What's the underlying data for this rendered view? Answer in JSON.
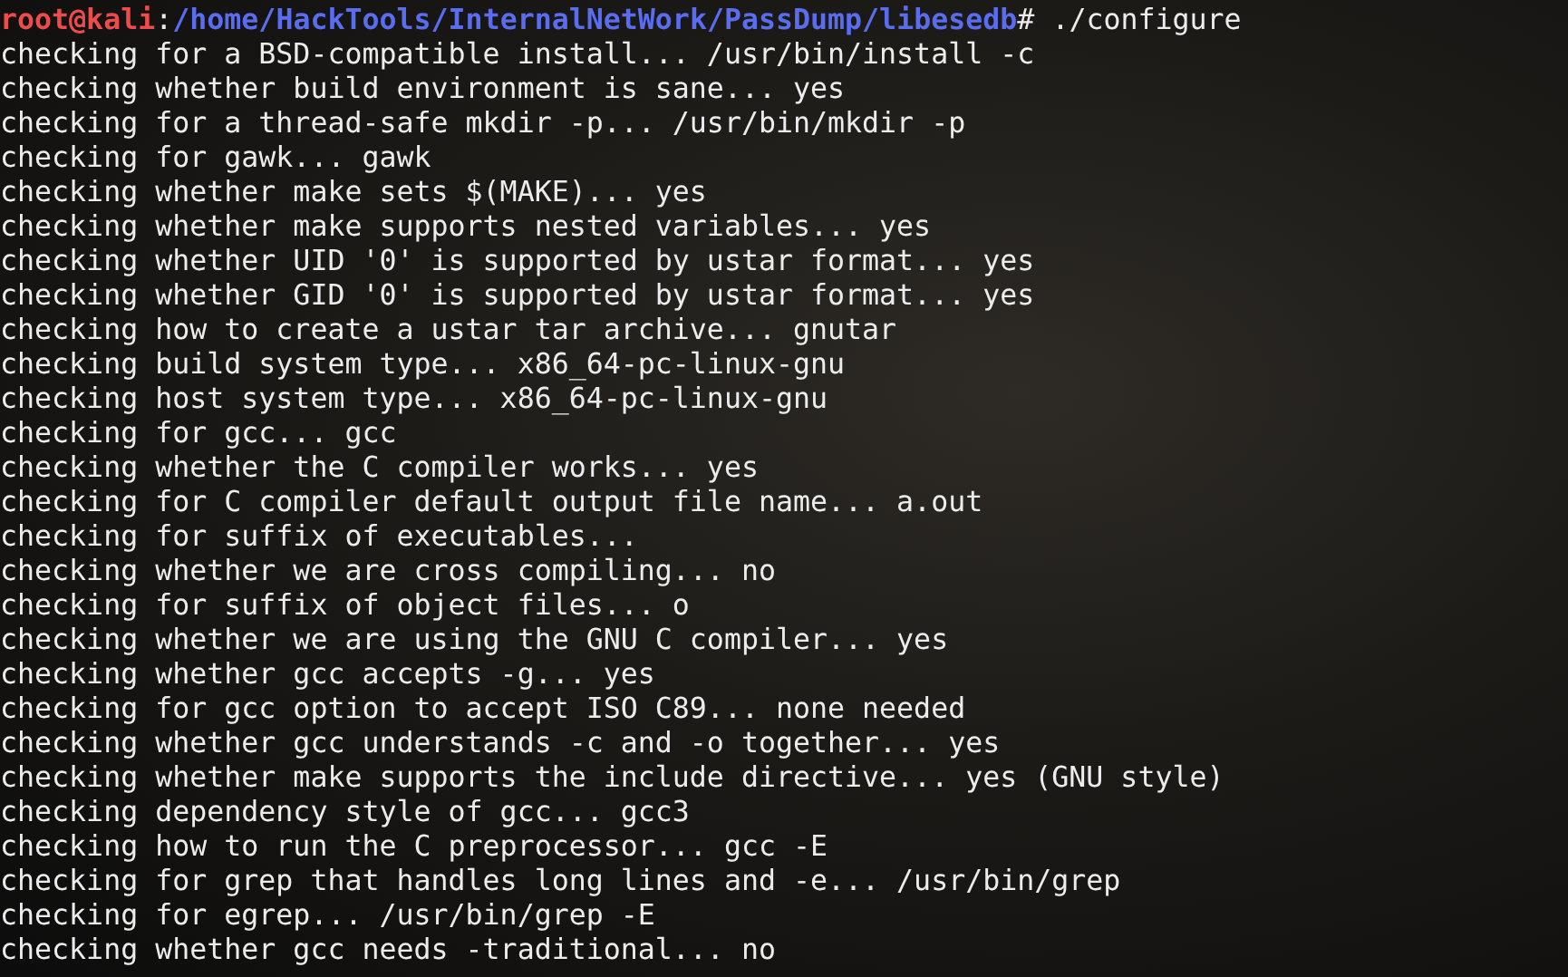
{
  "prompt": {
    "user": "root@kali",
    "separator": ":",
    "path": "/home/HackTools/InternalNetWork/PassDump/libesedb",
    "symbol": "#",
    "command": "./configure"
  },
  "output": [
    "checking for a BSD-compatible install... /usr/bin/install -c",
    "checking whether build environment is sane... yes",
    "checking for a thread-safe mkdir -p... /usr/bin/mkdir -p",
    "checking for gawk... gawk",
    "checking whether make sets $(MAKE)... yes",
    "checking whether make supports nested variables... yes",
    "checking whether UID '0' is supported by ustar format... yes",
    "checking whether GID '0' is supported by ustar format... yes",
    "checking how to create a ustar tar archive... gnutar",
    "checking build system type... x86_64-pc-linux-gnu",
    "checking host system type... x86_64-pc-linux-gnu",
    "checking for gcc... gcc",
    "checking whether the C compiler works... yes",
    "checking for C compiler default output file name... a.out",
    "checking for suffix of executables...",
    "checking whether we are cross compiling... no",
    "checking for suffix of object files... o",
    "checking whether we are using the GNU C compiler... yes",
    "checking whether gcc accepts -g... yes",
    "checking for gcc option to accept ISO C89... none needed",
    "checking whether gcc understands -c and -o together... yes",
    "checking whether make supports the include directive... yes (GNU style)",
    "checking dependency style of gcc... gcc3",
    "checking how to run the C preprocessor... gcc -E",
    "checking for grep that handles long lines and -e... /usr/bin/grep",
    "checking for egrep... /usr/bin/grep -E",
    "checking whether gcc needs -traditional... no"
  ]
}
